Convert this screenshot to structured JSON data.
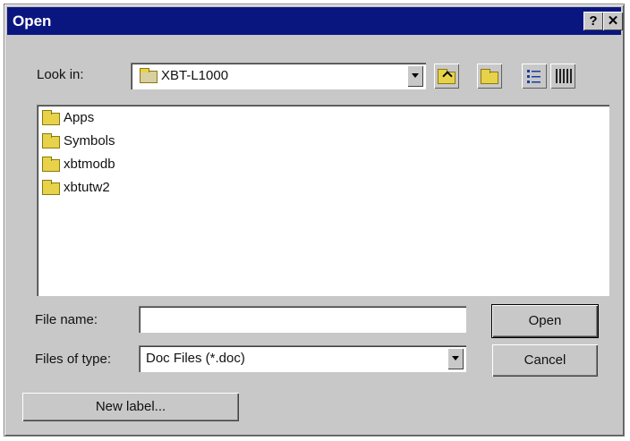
{
  "window": {
    "title": "Open",
    "help_label": "?",
    "close_label": "✕"
  },
  "look_in": {
    "label": "Look in:",
    "value": "XBT-L1000"
  },
  "toolbar": {
    "icons": [
      "up-one-level-icon",
      "create-new-folder-icon",
      "list-view-icon",
      "details-view-icon"
    ]
  },
  "files": [
    {
      "name": "Apps",
      "icon": "folder-icon"
    },
    {
      "name": "Symbols",
      "icon": "folder-icon"
    },
    {
      "name": "xbtmodb",
      "icon": "folder-icon"
    },
    {
      "name": "xbtutw2",
      "icon": "folder-icon"
    }
  ],
  "file_name": {
    "label": "File name:",
    "value": ""
  },
  "file_type": {
    "label": "Files of type:",
    "value": "Doc Files (*.doc)"
  },
  "buttons": {
    "open": "Open",
    "cancel": "Cancel",
    "new_label": "New label..."
  },
  "colors": {
    "titlebar": "#0a1680",
    "face": "#c8c8c8",
    "folder": "#e8d24a"
  }
}
